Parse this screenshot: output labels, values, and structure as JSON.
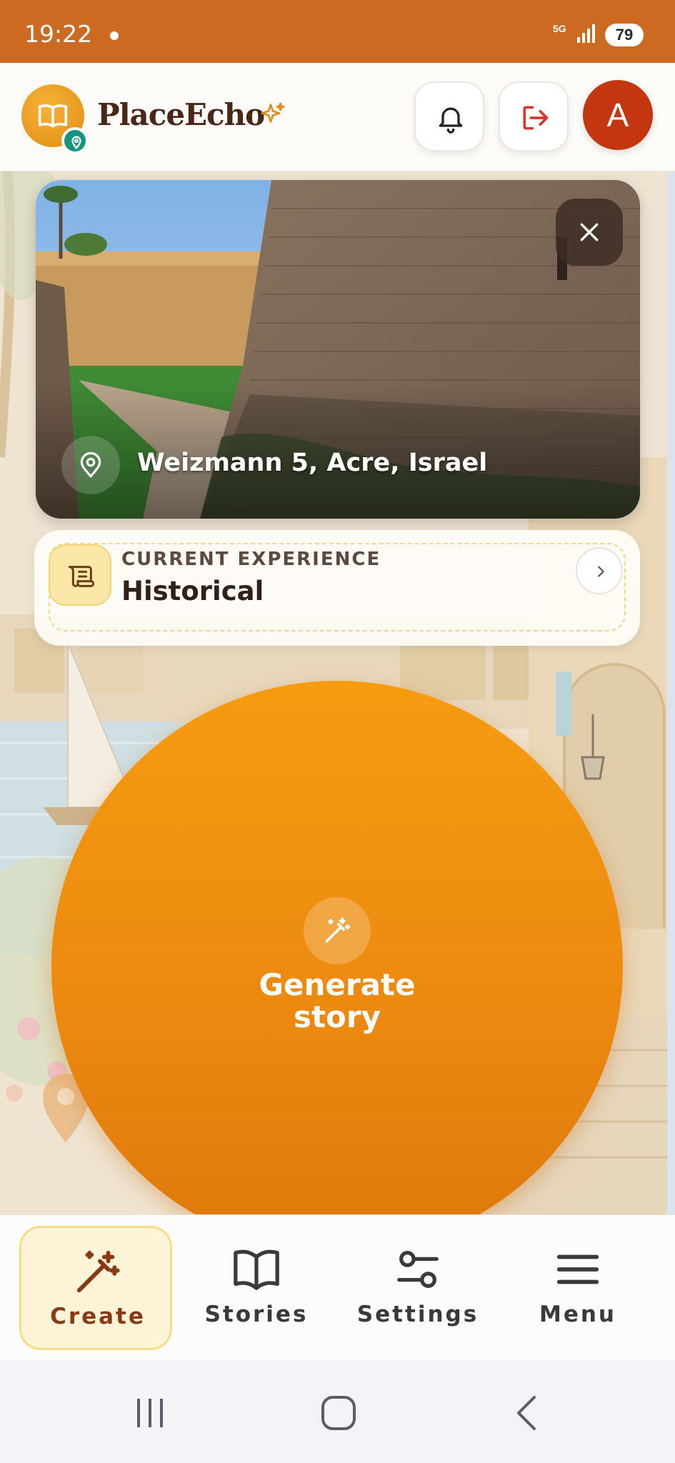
{
  "status_bar": {
    "time": "19:22",
    "network": "5G",
    "battery": "79"
  },
  "header": {
    "app_name": "PlaceEcho",
    "avatar_initial": "A"
  },
  "photo": {
    "location": "Weizmann 5, Acre, Israel"
  },
  "experience": {
    "label": "CURRENT EXPERIENCE",
    "value": "Historical"
  },
  "generate": {
    "label": "Generate story"
  },
  "bottom_nav": {
    "items": [
      {
        "label": "Create",
        "icon": "magic-wand-icon",
        "active": true
      },
      {
        "label": "Stories",
        "icon": "book-icon",
        "active": false
      },
      {
        "label": "Settings",
        "icon": "sliders-icon",
        "active": false
      },
      {
        "label": "Menu",
        "icon": "hamburger-icon",
        "active": false
      }
    ]
  },
  "colors": {
    "accent": "#ef8e10",
    "status_bar": "#cc6a22",
    "avatar": "#c4360f",
    "active_nav_bg": "#fdf4d8",
    "logout_red": "#d9362b"
  }
}
